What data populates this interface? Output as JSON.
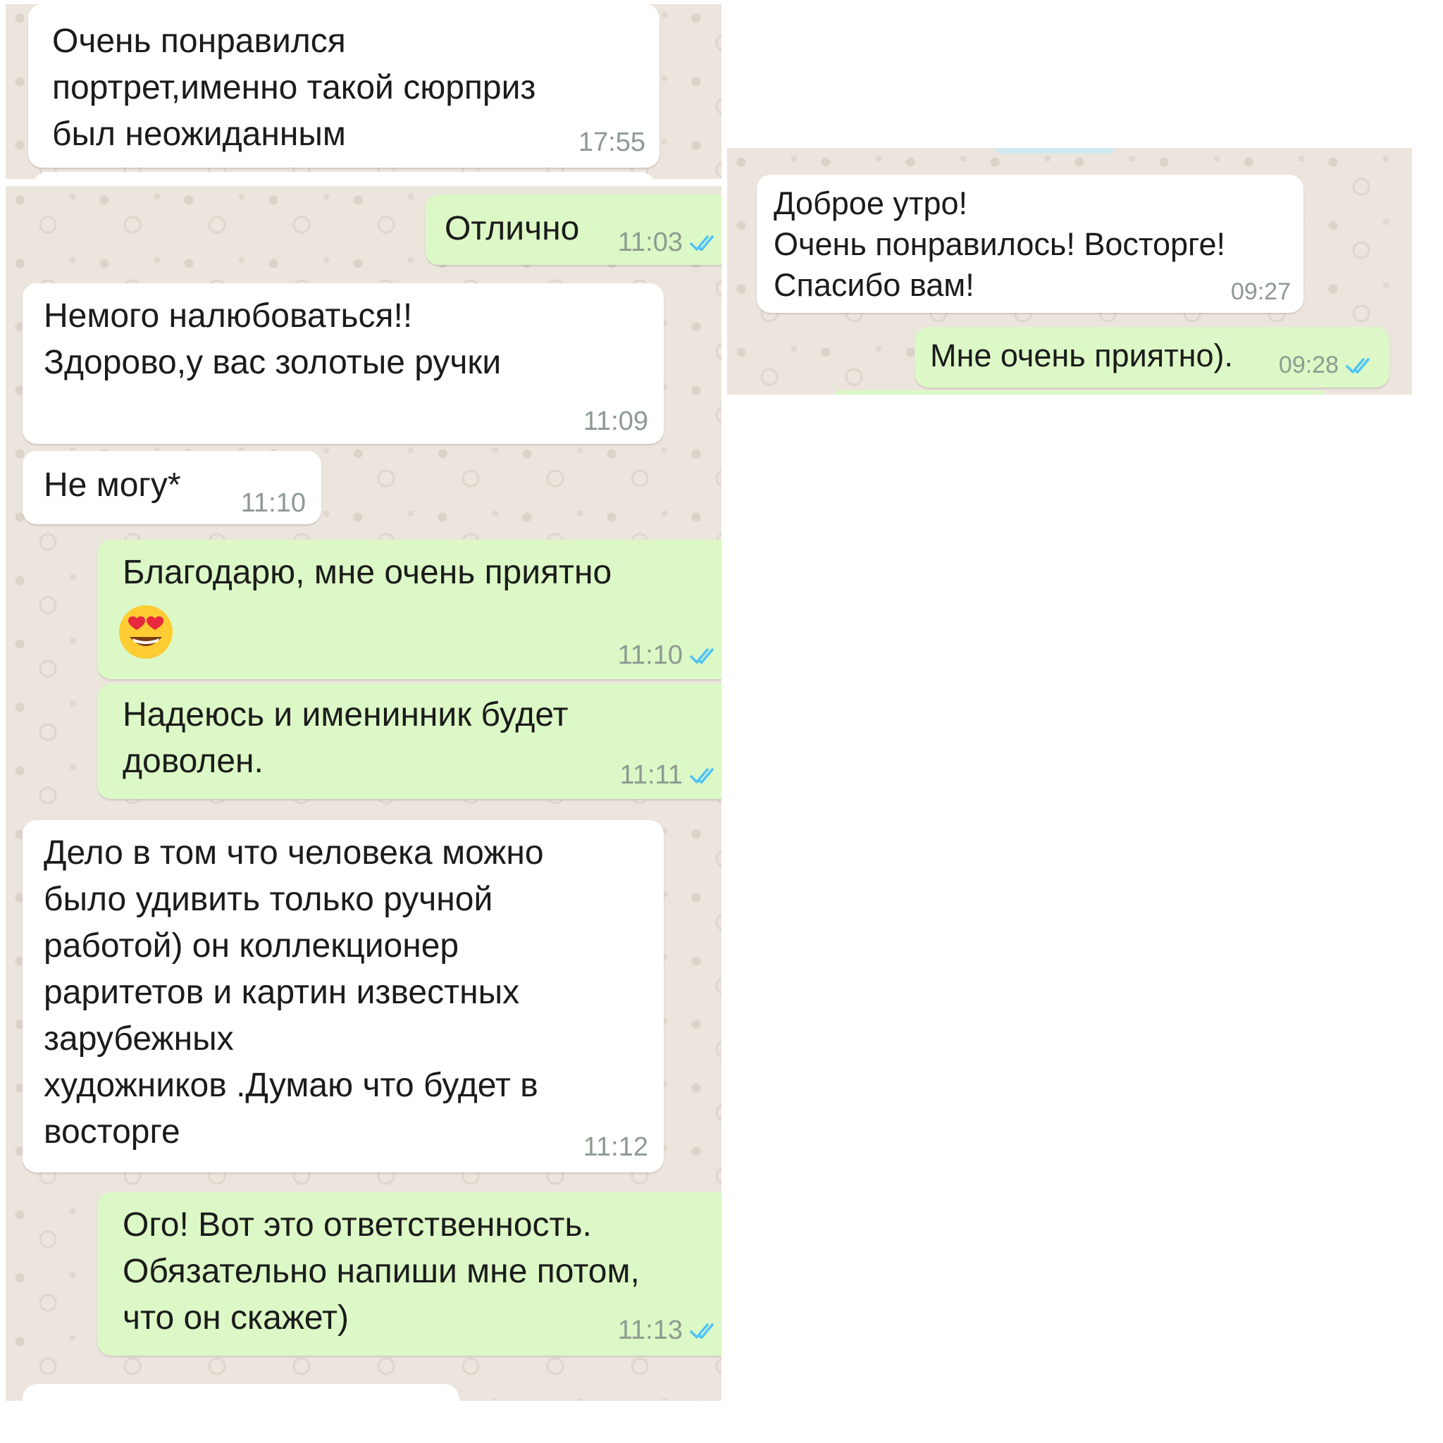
{
  "screenshot_1": {
    "messages": [
      {
        "direction": "incoming",
        "text": "Очень понравился\nпортрет,именно такой сюрприз\nбыл неожиданным",
        "time": "17:55"
      }
    ]
  },
  "screenshot_2": {
    "messages": [
      {
        "direction": "outgoing",
        "text": "Отлично",
        "time": "11:03",
        "read": true
      },
      {
        "direction": "incoming",
        "text": "Немого налюбоваться!!\nЗдорово,у вас золотые ручки",
        "time": "11:09"
      },
      {
        "direction": "incoming",
        "text": "Не могу*",
        "time": "11:10"
      },
      {
        "direction": "outgoing",
        "text": "Благодарю,  мне очень приятно",
        "emoji": "heart-eyes-emoji",
        "time": "11:10",
        "read": true
      },
      {
        "direction": "outgoing",
        "text": "Надеюсь и именинник будет\nдоволен.",
        "time": "11:11",
        "read": true
      },
      {
        "direction": "incoming",
        "text": "Дело в том что человека можно\nбыло удивить только ручной\nработой) он коллекционер\nраритетов и картин известных\nзарубежных\nхудожников .Думаю что будет в\nвосторге",
        "time": "11:12"
      },
      {
        "direction": "outgoing",
        "text": "Ого! Вот это ответственность.\nОбязательно напиши мне потом,\nчто он скажет)",
        "time": "11:13",
        "read": true
      }
    ]
  },
  "screenshot_3": {
    "messages": [
      {
        "direction": "incoming",
        "text": "Доброе утро!\nОчень понравилось! Восторге!\nСпасибо вам!",
        "time": "09:27"
      },
      {
        "direction": "outgoing",
        "text": "Мне очень приятно).",
        "time": "09:28",
        "read": true
      }
    ]
  },
  "colors": {
    "chat_background": "#ece5dd",
    "incoming_bubble": "#ffffff",
    "outgoing_bubble": "#dcf8c6",
    "timestamp": "#8e9a91",
    "read_ticks": "#4fc3f7"
  }
}
